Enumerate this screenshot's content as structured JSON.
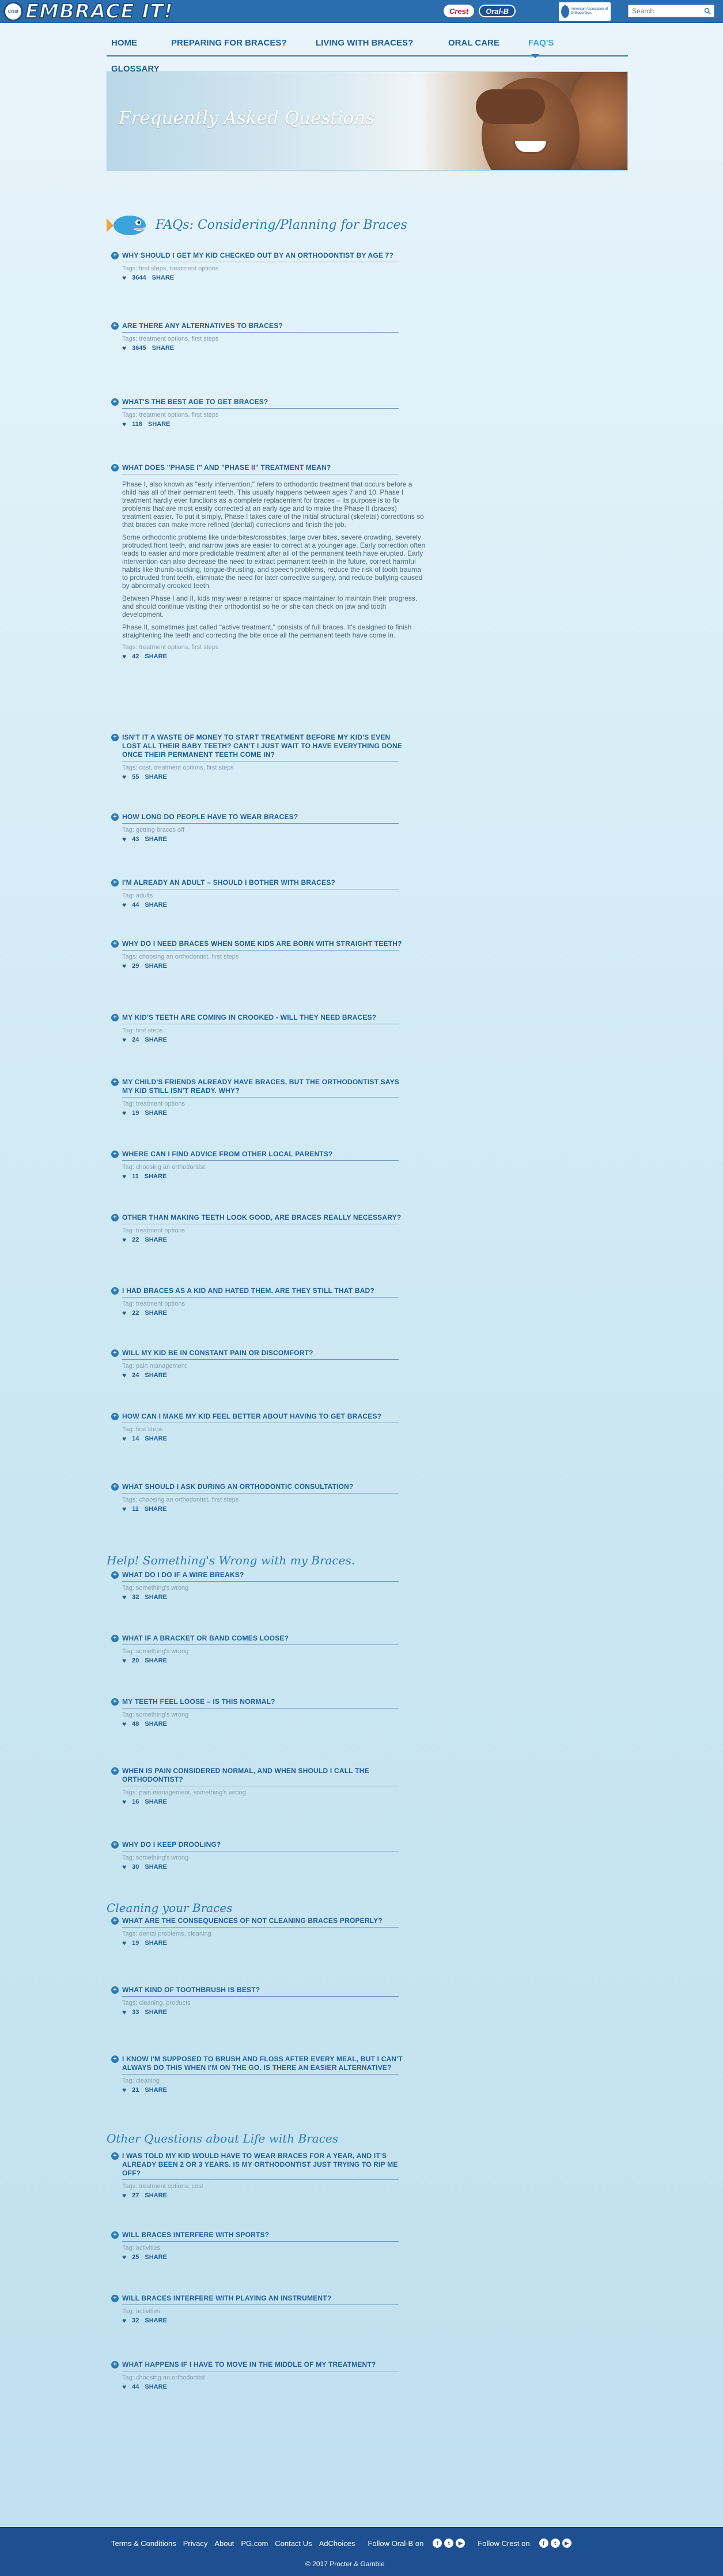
{
  "header": {
    "logo_text": "EMBRACE IT!",
    "logo_mark": "Crest",
    "partner1": "Crest",
    "partner2": "Oral-B",
    "aao_text": "American Association of Orthodontists",
    "search_placeholder": "Search"
  },
  "nav": {
    "items": [
      "HOME",
      "PREPARING FOR BRACES?",
      "LIVING WITH BRACES?",
      "ORAL CARE",
      "FAQ'S"
    ],
    "glossary": "GLOSSARY"
  },
  "hero": {
    "title": "Frequently Asked Questions"
  },
  "sections": {
    "s1": "FAQs: Considering/Planning for Braces",
    "s2": "Help! Something's Wrong with my Braces.",
    "s3": "Cleaning your Braces",
    "s4": "Other Questions about Life with Braces"
  },
  "share_label": "SHARE",
  "faqs": [
    {
      "q": "WHY SHOULD I GET MY KID CHECKED OUT BY AN ORTHODONTIST BY AGE 7?",
      "tags": "Tags: first steps, treatment options",
      "likes": "3644"
    },
    {
      "q": "ARE THERE ANY ALTERNATIVES TO BRACES?",
      "tags": "Tags: treatment options, first steps",
      "likes": "3645"
    },
    {
      "q": "WHAT'S THE BEST AGE TO GET BRACES?",
      "tags": "Tags: treatment options, first steps",
      "likes": "118"
    },
    {
      "q": "WHAT DOES \"PHASE I\" AND \"PHASE II\" TREATMENT MEAN?",
      "tags": "Tags: treatment options, first steps",
      "likes": "42",
      "body": [
        "Phase I, also known as \"early intervention,\" refers to orthodontic treatment that occurs before a child has all of their permanent teeth. This usually happens between ages 7 and 10. Phase I treatment hardly ever functions as a complete replacement for braces – its purpose is to fix problems that are most easily corrected at an early age and to make the Phase II (braces) treatment easier. To put it simply, Phase I takes care of the initial structural (skeletal) corrections so that braces can make more refined (dental) corrections and finish the job.",
        "Some orthodontic problems like underbites/crossbites, large over bites, severe crowding, severely protruded front teeth, and narrow jaws are easier to correct at a younger age. Early correction often leads to easier and more predictable treatment after all of the permanent teeth have erupted. Early intervention can also decrease the need to extract permanent teeth in the future, correct harmful habits like thumb-sucking, tongue-thrusting, and speech problems, reduce the risk of tooth trauma to protruded front teeth, eliminate the need for later corrective surgery, and reduce bullying caused by abnormally crooked teeth.",
        "Between Phase I and II, kids may wear a retainer or space maintainer to maintain their progress, and should continue visiting their orthodontist so he or she can check on jaw and tooth development.",
        "Phase II, sometimes just called \"active treatment,\" consists of full braces. It's designed to finish straightening the teeth and correcting the bite once all the permanent teeth have come in."
      ]
    },
    {
      "q": "ISN'T IT A WASTE OF MONEY TO START TREATMENT BEFORE MY KID'S EVEN LOST ALL THEIR BABY TEETH? CAN'T I JUST WAIT TO HAVE EVERYTHING DONE ONCE THEIR PERMANENT TEETH COME IN?",
      "tags": "Tags: cost, treatment options, first steps",
      "likes": "55"
    },
    {
      "q": "HOW LONG DO PEOPLE HAVE TO WEAR BRACES?",
      "tags": "Tag: getting braces off",
      "likes": "43"
    },
    {
      "q": "I'M ALREADY AN ADULT – SHOULD I BOTHER WITH BRACES?",
      "tags": "Tag: adults",
      "likes": "44"
    },
    {
      "q": "WHY DO I NEED BRACES WHEN SOME KIDS ARE BORN WITH STRAIGHT TEETH?",
      "tags": "Tags: choosing an orthodontist, first steps",
      "likes": "29"
    },
    {
      "q": "MY KID'S TEETH ARE COMING IN CROOKED - WILL THEY NEED BRACES?",
      "tags": "Tag: first steps",
      "likes": "24"
    },
    {
      "q": "MY CHILD'S FRIENDS ALREADY HAVE BRACES, BUT THE ORTHODONTIST SAYS MY KID STILL ISN'T READY. WHY?",
      "tags": "Tag: treatment options",
      "likes": "19"
    },
    {
      "q": "WHERE CAN I FIND ADVICE FROM OTHER LOCAL PARENTS?",
      "tags": "Tag: choosing an orthodontist",
      "likes": "11"
    },
    {
      "q": "OTHER THAN MAKING TEETH LOOK GOOD, ARE BRACES REALLY NECESSARY?",
      "tags": "Tag: treatment options",
      "likes": "22"
    },
    {
      "q": "I HAD BRACES AS A KID AND HATED THEM. ARE THEY STILL THAT BAD?",
      "tags": "Tag: treatment options",
      "likes": "22"
    },
    {
      "q": "WILL MY KID BE IN CONSTANT PAIN OR DISCOMFORT?",
      "tags": "Tag: pain management",
      "likes": "24"
    },
    {
      "q": "HOW CAN I MAKE MY KID FEEL BETTER ABOUT HAVING TO GET BRACES?",
      "tags": "Tag: first steps",
      "likes": "14"
    },
    {
      "q": "WHAT SHOULD I ASK DURING AN ORTHODONTIC CONSULTATION?",
      "tags": "Tags: choosing an orthodontist, first steps",
      "likes": "11"
    },
    {
      "q": "WHAT DO I DO IF A WIRE BREAKS?",
      "tags": "Tag: something's wrong",
      "likes": "32"
    },
    {
      "q": "WHAT IF A BRACKET OR BAND COMES LOOSE?",
      "tags": "Tag: something's wrong",
      "likes": "20"
    },
    {
      "q": "MY TEETH FEEL LOOSE – IS THIS NORMAL?",
      "tags": "Tag: something's wrong",
      "likes": "48"
    },
    {
      "q": "WHEN IS PAIN CONSIDERED NORMAL, AND WHEN SHOULD I CALL THE ORTHODONTIST?",
      "tags": "Tags: pain management, something's wrong",
      "likes": "16"
    },
    {
      "q": "WHY DO I KEEP DROOLING?",
      "tags": "Tag: something's wrong",
      "likes": "30"
    },
    {
      "q": "WHAT ARE THE CONSEQUENCES OF NOT CLEANING BRACES PROPERLY?",
      "tags": "Tags: dental problems, cleaning",
      "likes": "19"
    },
    {
      "q": "WHAT KIND OF TOOTHBRUSH IS BEST?",
      "tags": "Tags: cleaning, products",
      "likes": "33"
    },
    {
      "q": "I KNOW I'M SUPPOSED TO BRUSH AND FLOSS AFTER EVERY MEAL, BUT I CAN'T ALWAYS DO THIS WHEN I'M ON THE GO. IS THERE AN EASIER ALTERNATIVE?",
      "tags": "Tag: cleaning",
      "likes": "21"
    },
    {
      "q": "I WAS TOLD MY KID WOULD HAVE TO WEAR BRACES FOR A YEAR, AND IT'S ALREADY BEEN 2 OR 3 YEARS. IS MY ORTHODONTIST JUST TRYING TO RIP ME OFF?",
      "tags": "Tags: treatment options, cost",
      "likes": "27"
    },
    {
      "q": "WILL BRACES INTERFERE WITH SPORTS?",
      "tags": "Tag: activities",
      "likes": "25"
    },
    {
      "q": "WILL BRACES INTERFERE WITH PLAYING AN INSTRUMENT?",
      "tags": "Tag: activities",
      "likes": "32"
    },
    {
      "q": "WHAT HAPPENS IF I HAVE TO MOVE IN THE MIDDLE OF MY TREATMENT?",
      "tags": "Tag: choosing an orthodontist",
      "likes": "44"
    }
  ],
  "footer": {
    "links": [
      "Terms & Conditions",
      "Privacy",
      "About",
      "PG.com",
      "Contact Us",
      "AdChoices"
    ],
    "follow_oralb": "Follow Oral-B on",
    "follow_crest": "Follow Crest on",
    "copyright": "© 2017 Procter & Gamble"
  }
}
